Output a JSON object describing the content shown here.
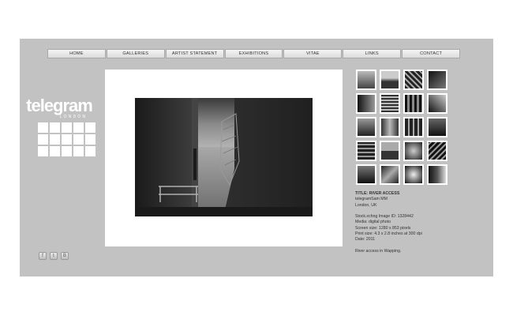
{
  "nav": {
    "items": [
      "HOME",
      "GALLERIES",
      "ARTIST STATEMENT",
      "EXHIBITIONS",
      "VITAE",
      "LINKS",
      "CONTACT"
    ]
  },
  "logo": {
    "main": "telegram",
    "sub": "LONDON"
  },
  "social": {
    "icons": [
      "facebook-icon",
      "twitter-icon",
      "blogger-icon"
    ]
  },
  "thumbnails": {
    "count": 20
  },
  "info": {
    "title": "TITLE: RIVER ACCESS",
    "author": "telegramSam MM",
    "location": "London, UK",
    "stock_id": "Stock.xchng Image ID: 1328442",
    "media": "Media: digital photo",
    "screen_size": "Screen size: 1280 x 853 pixels",
    "print_size": "Print size: 4.3 x 2.8 inches at 300 dpi",
    "date": "Date: 2011",
    "description": "River access in Wapping."
  },
  "colors": {
    "background": "#c2c2c2",
    "panel": "#ffffff",
    "text": "#333333"
  }
}
